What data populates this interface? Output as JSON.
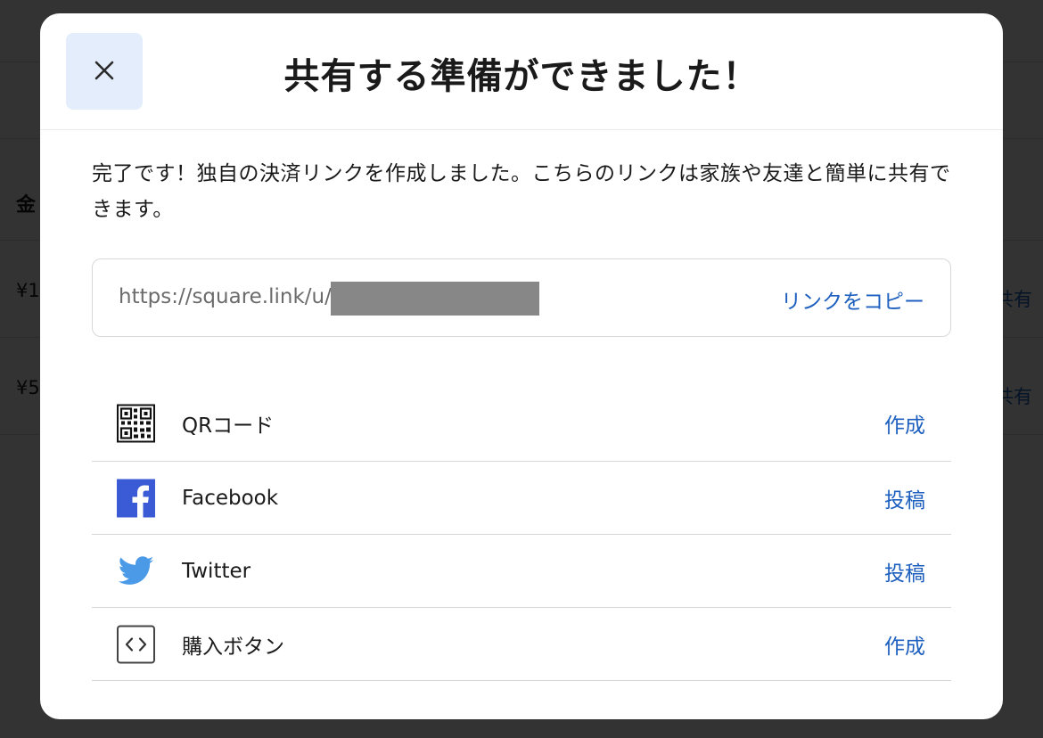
{
  "background": {
    "table_header_partial": "金",
    "rows": [
      {
        "amount_partial": "¥1",
        "action_partial": "共有"
      },
      {
        "amount_partial": "¥5",
        "action_partial": "共有"
      }
    ]
  },
  "modal": {
    "title": "共有する準備ができました！",
    "close_icon": "close-icon",
    "intro_text": "完了です！独自の決済リンクを作成しました。こちらのリンクは家族や友達と簡単に共有できます。",
    "link": {
      "url": "https://square.link/u/",
      "copy_label": "リンクをコピー"
    },
    "share_options": [
      {
        "icon": "qr-code-icon",
        "label": "QRコード",
        "action": "作成"
      },
      {
        "icon": "facebook-icon",
        "label": "Facebook",
        "action": "投稿"
      },
      {
        "icon": "twitter-icon",
        "label": "Twitter",
        "action": "投稿"
      },
      {
        "icon": "embed-code-icon",
        "label": "購入ボタン",
        "action": "作成"
      }
    ]
  },
  "colors": {
    "accent_link": "#1d5fbf",
    "close_button_bg": "#e3edfb",
    "facebook_blue": "#3b5bd6",
    "twitter_blue": "#4a9ae8"
  }
}
